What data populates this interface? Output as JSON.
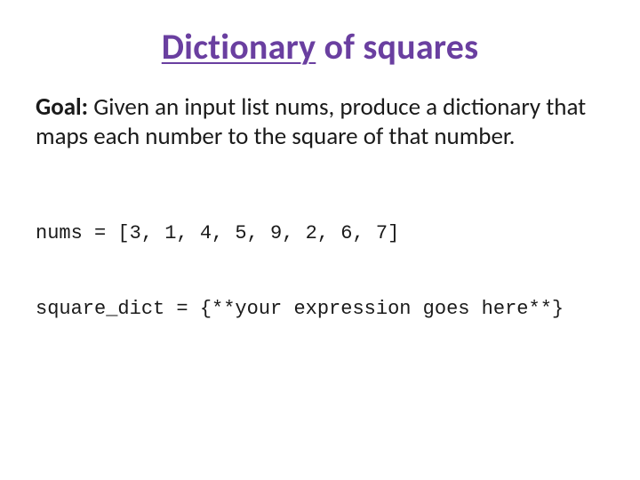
{
  "title": {
    "underlined": "Dictionary",
    "rest": " of squares"
  },
  "goal": {
    "label": "Goal:",
    "text": "  Given an input list nums, produce a dictionary that maps each number to the square of that number."
  },
  "code": {
    "line1": "nums = [3, 1, 4, 5, 9, 2, 6, 7]",
    "line2": "square_dict = {**your expression goes here**}"
  }
}
